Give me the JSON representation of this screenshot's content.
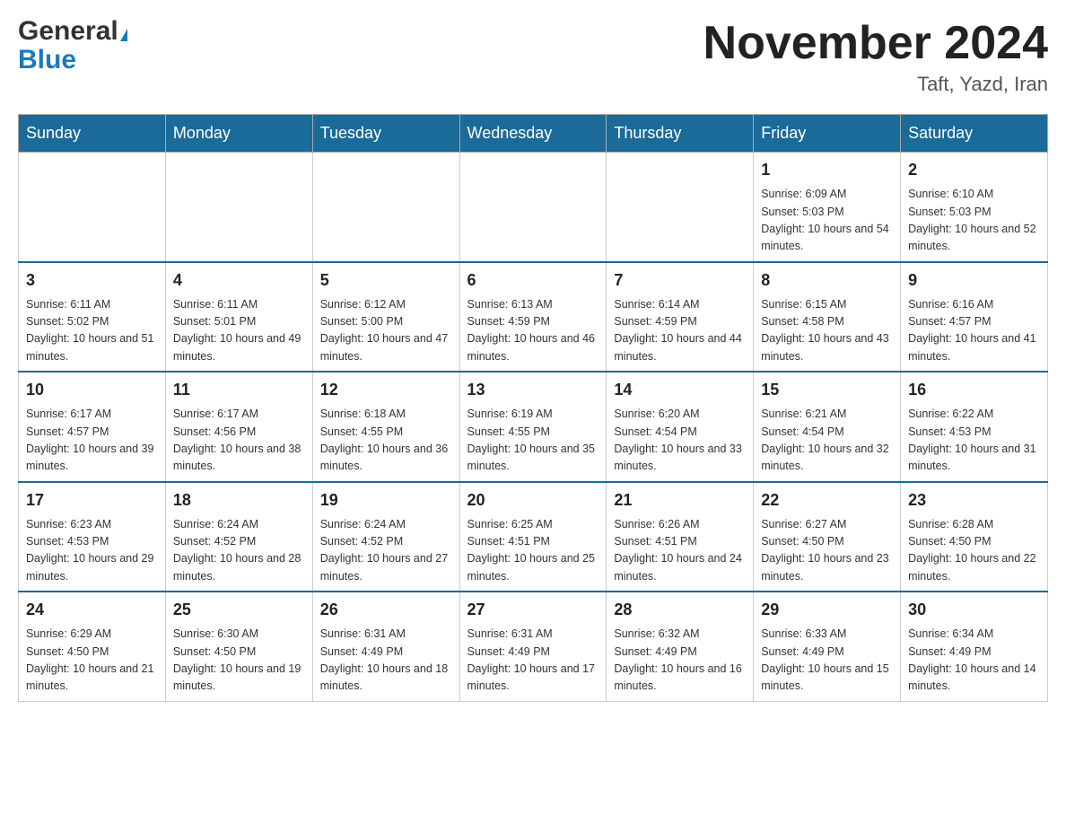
{
  "logo": {
    "general": "General",
    "blue": "Blue",
    "triangle": "▶"
  },
  "title": "November 2024",
  "location": "Taft, Yazd, Iran",
  "days_of_week": [
    "Sunday",
    "Monday",
    "Tuesday",
    "Wednesday",
    "Thursday",
    "Friday",
    "Saturday"
  ],
  "weeks": [
    [
      {
        "day": "",
        "info": ""
      },
      {
        "day": "",
        "info": ""
      },
      {
        "day": "",
        "info": ""
      },
      {
        "day": "",
        "info": ""
      },
      {
        "day": "",
        "info": ""
      },
      {
        "day": "1",
        "info": "Sunrise: 6:09 AM\nSunset: 5:03 PM\nDaylight: 10 hours and 54 minutes."
      },
      {
        "day": "2",
        "info": "Sunrise: 6:10 AM\nSunset: 5:03 PM\nDaylight: 10 hours and 52 minutes."
      }
    ],
    [
      {
        "day": "3",
        "info": "Sunrise: 6:11 AM\nSunset: 5:02 PM\nDaylight: 10 hours and 51 minutes."
      },
      {
        "day": "4",
        "info": "Sunrise: 6:11 AM\nSunset: 5:01 PM\nDaylight: 10 hours and 49 minutes."
      },
      {
        "day": "5",
        "info": "Sunrise: 6:12 AM\nSunset: 5:00 PM\nDaylight: 10 hours and 47 minutes."
      },
      {
        "day": "6",
        "info": "Sunrise: 6:13 AM\nSunset: 4:59 PM\nDaylight: 10 hours and 46 minutes."
      },
      {
        "day": "7",
        "info": "Sunrise: 6:14 AM\nSunset: 4:59 PM\nDaylight: 10 hours and 44 minutes."
      },
      {
        "day": "8",
        "info": "Sunrise: 6:15 AM\nSunset: 4:58 PM\nDaylight: 10 hours and 43 minutes."
      },
      {
        "day": "9",
        "info": "Sunrise: 6:16 AM\nSunset: 4:57 PM\nDaylight: 10 hours and 41 minutes."
      }
    ],
    [
      {
        "day": "10",
        "info": "Sunrise: 6:17 AM\nSunset: 4:57 PM\nDaylight: 10 hours and 39 minutes."
      },
      {
        "day": "11",
        "info": "Sunrise: 6:17 AM\nSunset: 4:56 PM\nDaylight: 10 hours and 38 minutes."
      },
      {
        "day": "12",
        "info": "Sunrise: 6:18 AM\nSunset: 4:55 PM\nDaylight: 10 hours and 36 minutes."
      },
      {
        "day": "13",
        "info": "Sunrise: 6:19 AM\nSunset: 4:55 PM\nDaylight: 10 hours and 35 minutes."
      },
      {
        "day": "14",
        "info": "Sunrise: 6:20 AM\nSunset: 4:54 PM\nDaylight: 10 hours and 33 minutes."
      },
      {
        "day": "15",
        "info": "Sunrise: 6:21 AM\nSunset: 4:54 PM\nDaylight: 10 hours and 32 minutes."
      },
      {
        "day": "16",
        "info": "Sunrise: 6:22 AM\nSunset: 4:53 PM\nDaylight: 10 hours and 31 minutes."
      }
    ],
    [
      {
        "day": "17",
        "info": "Sunrise: 6:23 AM\nSunset: 4:53 PM\nDaylight: 10 hours and 29 minutes."
      },
      {
        "day": "18",
        "info": "Sunrise: 6:24 AM\nSunset: 4:52 PM\nDaylight: 10 hours and 28 minutes."
      },
      {
        "day": "19",
        "info": "Sunrise: 6:24 AM\nSunset: 4:52 PM\nDaylight: 10 hours and 27 minutes."
      },
      {
        "day": "20",
        "info": "Sunrise: 6:25 AM\nSunset: 4:51 PM\nDaylight: 10 hours and 25 minutes."
      },
      {
        "day": "21",
        "info": "Sunrise: 6:26 AM\nSunset: 4:51 PM\nDaylight: 10 hours and 24 minutes."
      },
      {
        "day": "22",
        "info": "Sunrise: 6:27 AM\nSunset: 4:50 PM\nDaylight: 10 hours and 23 minutes."
      },
      {
        "day": "23",
        "info": "Sunrise: 6:28 AM\nSunset: 4:50 PM\nDaylight: 10 hours and 22 minutes."
      }
    ],
    [
      {
        "day": "24",
        "info": "Sunrise: 6:29 AM\nSunset: 4:50 PM\nDaylight: 10 hours and 21 minutes."
      },
      {
        "day": "25",
        "info": "Sunrise: 6:30 AM\nSunset: 4:50 PM\nDaylight: 10 hours and 19 minutes."
      },
      {
        "day": "26",
        "info": "Sunrise: 6:31 AM\nSunset: 4:49 PM\nDaylight: 10 hours and 18 minutes."
      },
      {
        "day": "27",
        "info": "Sunrise: 6:31 AM\nSunset: 4:49 PM\nDaylight: 10 hours and 17 minutes."
      },
      {
        "day": "28",
        "info": "Sunrise: 6:32 AM\nSunset: 4:49 PM\nDaylight: 10 hours and 16 minutes."
      },
      {
        "day": "29",
        "info": "Sunrise: 6:33 AM\nSunset: 4:49 PM\nDaylight: 10 hours and 15 minutes."
      },
      {
        "day": "30",
        "info": "Sunrise: 6:34 AM\nSunset: 4:49 PM\nDaylight: 10 hours and 14 minutes."
      }
    ]
  ]
}
